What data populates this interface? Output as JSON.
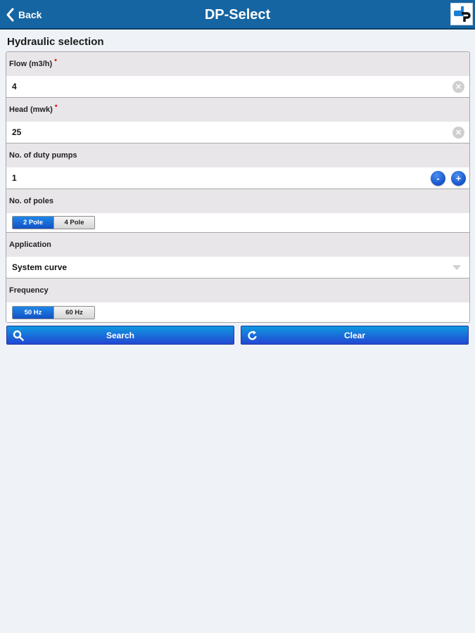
{
  "navbar": {
    "back_label": "Back",
    "title": "DP-Select",
    "logo_icon": "dp-logo-icon"
  },
  "section": {
    "title": "Hydraulic selection"
  },
  "form": {
    "flow": {
      "label": "Flow (m3/h)",
      "required_mark": "•",
      "value": "4",
      "clear_glyph": "✕"
    },
    "head": {
      "label": "Head (mwk)",
      "required_mark": "•",
      "value": "25",
      "clear_glyph": "✕"
    },
    "duty_pumps": {
      "label": "No. of duty pumps",
      "value": "1",
      "decrement_label": "-",
      "increment_label": "+"
    },
    "poles": {
      "label": "No. of poles",
      "options": [
        "2 Pole",
        "4 Pole"
      ],
      "selected": "2 Pole"
    },
    "application": {
      "label": "Application",
      "value": "System curve"
    },
    "frequency": {
      "label": "Frequency",
      "options": [
        "50 Hz",
        "60 Hz"
      ],
      "selected": "50 Hz"
    }
  },
  "actions": {
    "search_label": "Search",
    "clear_label": "Clear"
  },
  "colors": {
    "navbar": "#1565a2",
    "accent_blue": "#1451c6",
    "required": "#e0201a",
    "background": "#eff3f8"
  }
}
